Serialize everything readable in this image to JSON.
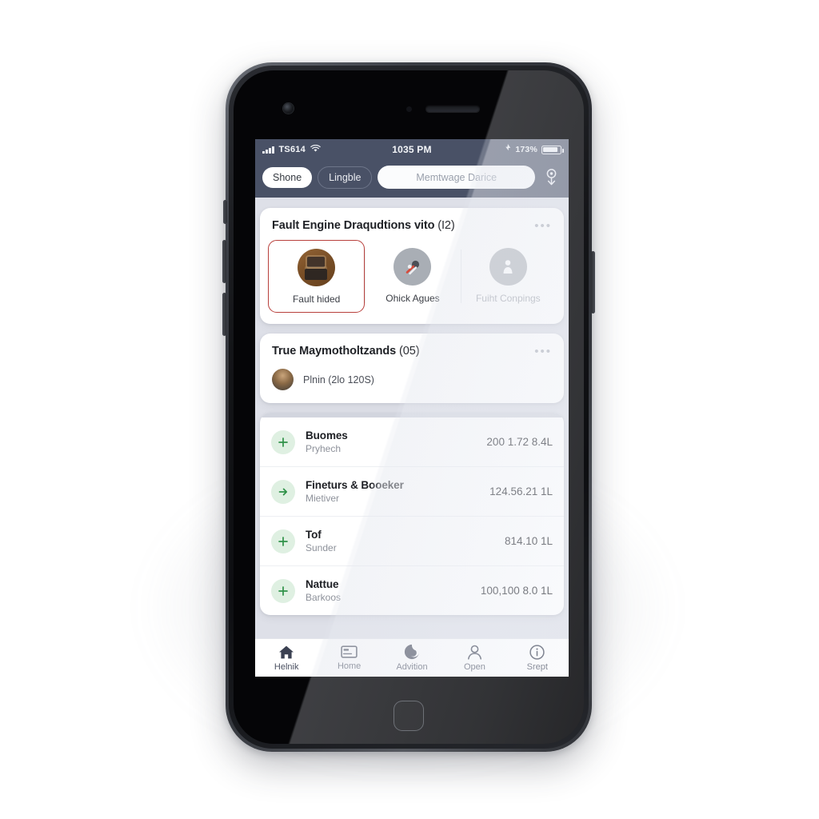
{
  "status_bar": {
    "carrier": "TS614",
    "signal_icon": "signal-bars-icon",
    "wifi_icon": "wifi-icon",
    "time": "1035 PM",
    "alarm_icon": "alarm-icon",
    "battery_percent": "173%",
    "battery_icon": "battery-icon"
  },
  "topbar": {
    "filter_active": "Shone",
    "filter_secondary": "Lingble",
    "search_placeholder": "Memtwage Darice",
    "search_value": "",
    "mic_icon": "download-pin-icon"
  },
  "quick_card": {
    "title": "Fault Engine Draqudtions vito",
    "count": "(I2)",
    "menu_icon": "overflow-menu-icon",
    "tiles": [
      {
        "label": "Fault hided",
        "icon": "engine-photo-icon",
        "selected": true
      },
      {
        "label": "Ohick Agues",
        "icon": "wrench-tools-icon",
        "selected": false
      },
      {
        "label": "Fuiht Conpings",
        "icon": "person-seat-icon",
        "selected": false,
        "muted": true
      }
    ]
  },
  "contacts_card": {
    "title": "True Maymotholtzands",
    "count": "(05)",
    "menu_icon": "overflow-menu-icon",
    "contact": {
      "name": "Plnin (2lo 120S)",
      "avatar_icon": "user-avatar"
    }
  },
  "transactions": [
    {
      "title": "Buomes",
      "subtitle": "Pryhech",
      "amount": "200 1.72 8.4L",
      "icon": "plus-icon"
    },
    {
      "title": "Fineturs & Booeker",
      "subtitle": "Mietiver",
      "amount": "124.56.21 1L",
      "icon": "arrow-right-icon"
    },
    {
      "title": "Tof",
      "subtitle": "Sunder",
      "amount": "814.10 1L",
      "icon": "plus-icon"
    },
    {
      "title": "Nattue",
      "subtitle": "Barkoos",
      "amount": "100,100 8.0 1L",
      "icon": "plus-icon"
    }
  ],
  "tabbar": [
    {
      "label": "Helnik",
      "icon": "home-house-icon"
    },
    {
      "label": "Home",
      "icon": "card-icon"
    },
    {
      "label": "Advition",
      "icon": "swirl-icon"
    },
    {
      "label": "Open",
      "icon": "person-icon"
    },
    {
      "label": "Srept",
      "icon": "info-circle-icon"
    }
  ],
  "colors": {
    "statusbar": "#495166",
    "page_background": "#dee0e8",
    "accent_selected": "#b8403c",
    "txn_icon_green": "#2f9148",
    "tab_text": "#4a5061"
  }
}
